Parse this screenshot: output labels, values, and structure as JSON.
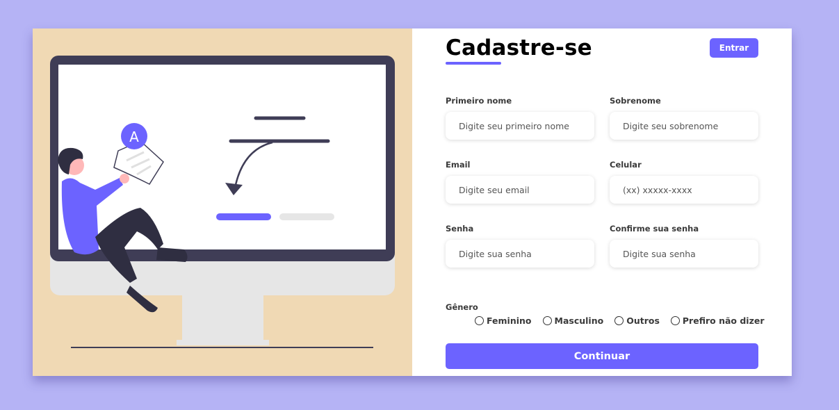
{
  "page": {
    "title": "Cadastre-se",
    "login_label": "Entrar",
    "accent_color": "#6c63ff",
    "illustration_badge": "A"
  },
  "form": {
    "fields": [
      {
        "label": "Primeiro nome",
        "placeholder": "Digite seu primeiro nome"
      },
      {
        "label": "Sobrenome",
        "placeholder": "Digite seu sobrenome"
      },
      {
        "label": "Email",
        "placeholder": "Digite seu email"
      },
      {
        "label": "Celular",
        "placeholder": "(xx) xxxxx-xxxx"
      },
      {
        "label": "Senha",
        "placeholder": "Digite sua senha"
      },
      {
        "label": "Confirme sua senha",
        "placeholder": "Digite sua senha"
      }
    ],
    "gender": {
      "label": "Gênero",
      "options": [
        "Feminino",
        "Masculino",
        "Outros",
        "Prefiro não dizer"
      ]
    },
    "submit_label": "Continuar"
  }
}
